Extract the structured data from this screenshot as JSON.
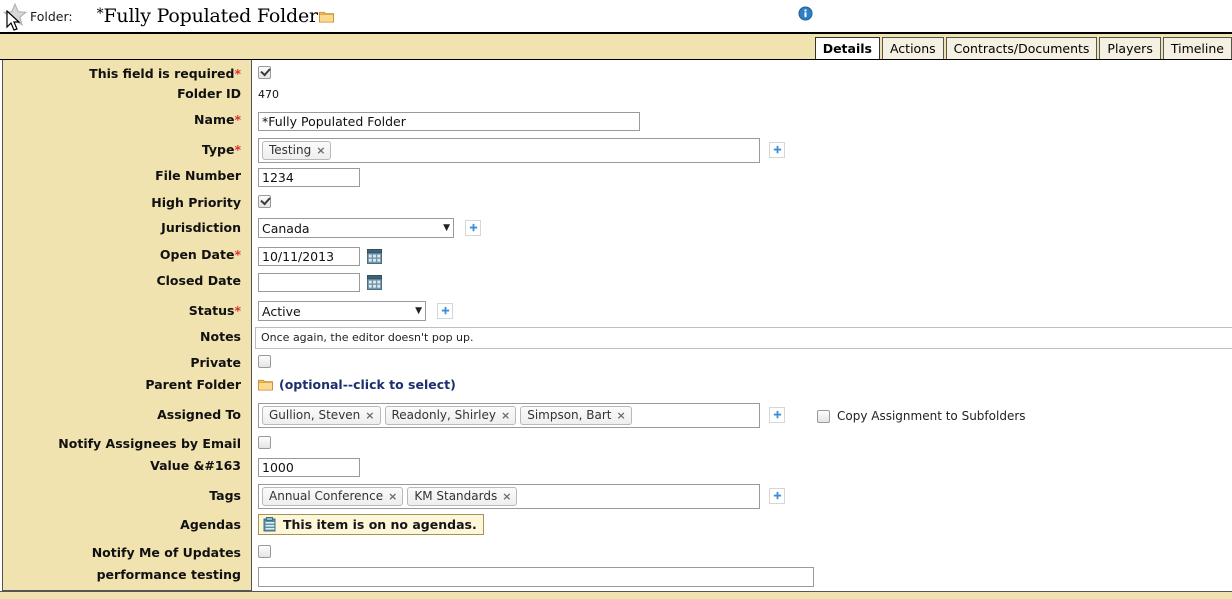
{
  "header": {
    "star_icon": "star-icon",
    "cursor_icon": "mouse-cursor",
    "label": "Folder:",
    "title_prefix": "*",
    "title": "Fully Populated Folder",
    "folder_icon": "folder-icon",
    "info_icon": "info-icon"
  },
  "tabs": [
    {
      "label": "Details",
      "active": true
    },
    {
      "label": "Actions",
      "active": false
    },
    {
      "label": "Contracts/Documents",
      "active": false
    },
    {
      "label": "Players",
      "active": false
    },
    {
      "label": "Timeline",
      "active": false
    }
  ],
  "form": {
    "required_marker": "*",
    "rows": {
      "required_field": {
        "label": "This field is required",
        "checked": true
      },
      "folder_id": {
        "label": "Folder ID",
        "value": "470"
      },
      "name": {
        "label": "Name",
        "value": "*Fully Populated Folder"
      },
      "type": {
        "label": "Type",
        "tokens": [
          "Testing"
        ]
      },
      "file_number": {
        "label": "File Number",
        "value": "1234"
      },
      "high_priority": {
        "label": "High Priority",
        "checked": true
      },
      "jurisdiction": {
        "label": "Jurisdiction",
        "value": "Canada"
      },
      "open_date": {
        "label": "Open Date",
        "value": "10/11/2013"
      },
      "closed_date": {
        "label": "Closed Date",
        "value": ""
      },
      "status": {
        "label": "Status",
        "value": "Active"
      },
      "notes": {
        "label": "Notes",
        "value": "Once again, the editor doesn't pop up."
      },
      "private": {
        "label": "Private",
        "checked": false
      },
      "parent_folder": {
        "label": "Parent Folder",
        "link": "(optional--click to select)"
      },
      "assigned_to": {
        "label": "Assigned To",
        "tokens": [
          "Gullion, Steven",
          "Readonly, Shirley",
          "Simpson, Bart"
        ],
        "copy_label": "Copy Assignment to Subfolders",
        "copy_checked": false
      },
      "notify_assignees": {
        "label": "Notify Assignees by Email",
        "checked": false
      },
      "value_gbp": {
        "label": "Value &#163",
        "value": "1000"
      },
      "tags": {
        "label": "Tags",
        "tokens": [
          "Annual Conference",
          "KM Standards"
        ]
      },
      "agendas": {
        "label": "Agendas",
        "badge": "This item is on no agendas."
      },
      "notify_me": {
        "label": "Notify Me of Updates",
        "checked": false
      },
      "performance_testing": {
        "label": "performance testing",
        "value": ""
      }
    },
    "token_remove_glyph": "×"
  },
  "colors": {
    "band": "#f0e3b0",
    "accent_blue": "#3d8fd6",
    "required_red": "#e03030",
    "link_navy": "#1c2f6e",
    "folder_orange": "#e9a93a"
  }
}
